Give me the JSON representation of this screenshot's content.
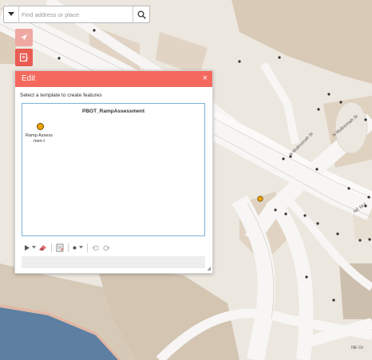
{
  "search": {
    "placeholder": "Find address or place"
  },
  "toolbar": {
    "buttons": [
      "locate-icon",
      "edit-icon"
    ]
  },
  "edit_panel": {
    "title": "Edit",
    "close": "×",
    "instruction": "Select a template to create features",
    "layer_name": "PBOT_RampAssessment",
    "templates": [
      {
        "label": "Ramp Assessmen t",
        "symbol_color": "#f1a300"
      }
    ],
    "toolbar_icons": [
      "select-icon",
      "dropdown-arrow-icon",
      "eraser-icon",
      "attributes-icon",
      "point-icon",
      "dropdown-arrow-icon",
      "undo-icon",
      "redo-icon"
    ]
  },
  "map": {
    "street_labels": [
      "N Multnomah St",
      "N Multnomah St",
      "NE Mul",
      "NE Or"
    ],
    "colors": {
      "land": "#ece7df",
      "parcel": "#ddcfbe",
      "road": "#f7f6f4",
      "water": "#5d7fa1",
      "shore": "#e3b6a2",
      "accent": "#f4685e",
      "feature_point": "#f1a300"
    }
  }
}
